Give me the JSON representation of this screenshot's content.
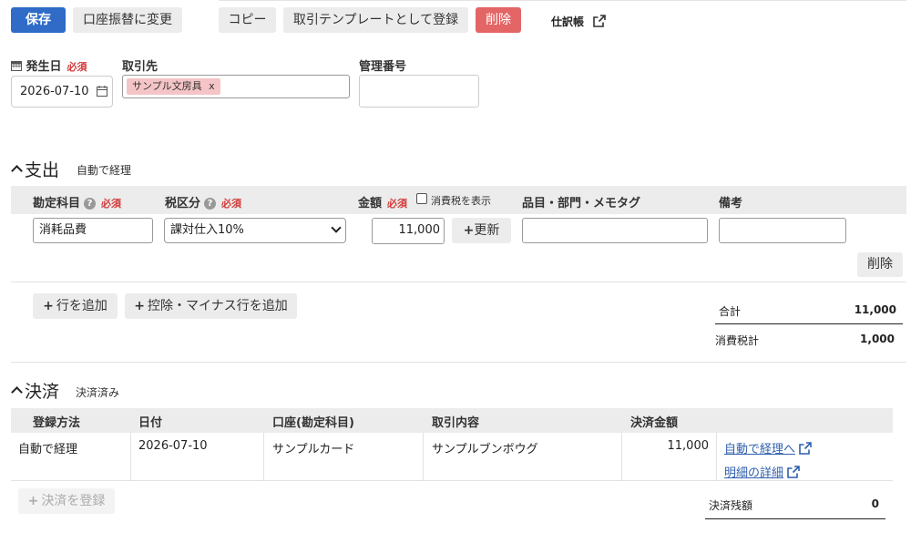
{
  "toolbar": {
    "save": "保存",
    "convert_transfer": "口座振替に変更",
    "copy": "コピー",
    "register_template": "取引テンプレートとして登録",
    "delete": "削除",
    "journal": "仕訳帳"
  },
  "form": {
    "issue_date_label": "発生日",
    "required": "必須",
    "issue_date_value": "2026-07-10",
    "partner_label": "取引先",
    "partner_tag": "サンプル文房具",
    "partner_tag_remove": "x",
    "mgmt_no_label": "管理番号",
    "mgmt_no_value": ""
  },
  "expense": {
    "title": "支出",
    "subtitle": "自動で経理",
    "headers": {
      "account": "勘定科目",
      "tax": "税区分",
      "amount": "金額",
      "show_tax": "消費税を表示",
      "item": "品目・部門・メモタグ",
      "note": "備考"
    },
    "row": {
      "account": "消耗品費",
      "tax": "課対仕入10%",
      "amount": "11,000",
      "update": "更新",
      "item": "",
      "note": ""
    },
    "delete_row": "削除",
    "add_row": "行を追加",
    "add_minus_row": "控除・マイナス行を追加",
    "total_label": "合計",
    "total_value": "11,000",
    "tax_label": "消費税計",
    "tax_value": "1,000"
  },
  "settlement": {
    "title": "決済",
    "subtitle": "決済済み",
    "headers": {
      "method": "登録方法",
      "date": "日付",
      "account": "口座(勘定科目)",
      "content": "取引内容",
      "amount": "決済金額"
    },
    "row": {
      "method": "自動で経理",
      "date": "2026-07-10",
      "account": "サンプルカード",
      "content": "サンプルブンボウグ",
      "amount": "11,000",
      "link_auto": "自動で経理へ",
      "link_detail": "明細の詳細"
    },
    "add_settlement": "決済を登録",
    "balance_label": "決済残額",
    "balance_value": "0"
  },
  "colors": {
    "primary": "#2f6bc7",
    "danger": "#e36566",
    "required": "#d23b3b",
    "link": "#2f5fae",
    "tag_bg": "#f5c4c7"
  }
}
